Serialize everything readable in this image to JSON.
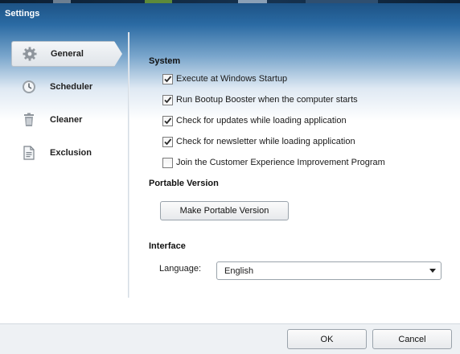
{
  "window": {
    "title": "Settings"
  },
  "sidebar": {
    "items": [
      {
        "label": "General",
        "icon": "gear-icon",
        "active": true
      },
      {
        "label": "Scheduler",
        "icon": "clock-icon",
        "active": false
      },
      {
        "label": "Cleaner",
        "icon": "trash-icon",
        "active": false
      },
      {
        "label": "Exclusion",
        "icon": "document-icon",
        "active": false
      }
    ]
  },
  "system": {
    "heading": "System",
    "options": [
      {
        "label": "Execute at Windows Startup",
        "checked": true
      },
      {
        "label": "Run Bootup Booster when the computer starts",
        "checked": true
      },
      {
        "label": "Check for updates while loading application",
        "checked": true
      },
      {
        "label": "Check for newsletter while loading application",
        "checked": true
      },
      {
        "label": "Join the Customer Experience Improvement Program",
        "checked": false
      }
    ]
  },
  "portable": {
    "heading": "Portable Version",
    "button_label": "Make Portable Version"
  },
  "interface": {
    "heading": "Interface",
    "language_label": "Language:",
    "language_value": "English"
  },
  "footer": {
    "ok_label": "OK",
    "cancel_label": "Cancel"
  },
  "colors": {
    "title_bar": "#1b4f80",
    "check": "#2b2b2b"
  }
}
